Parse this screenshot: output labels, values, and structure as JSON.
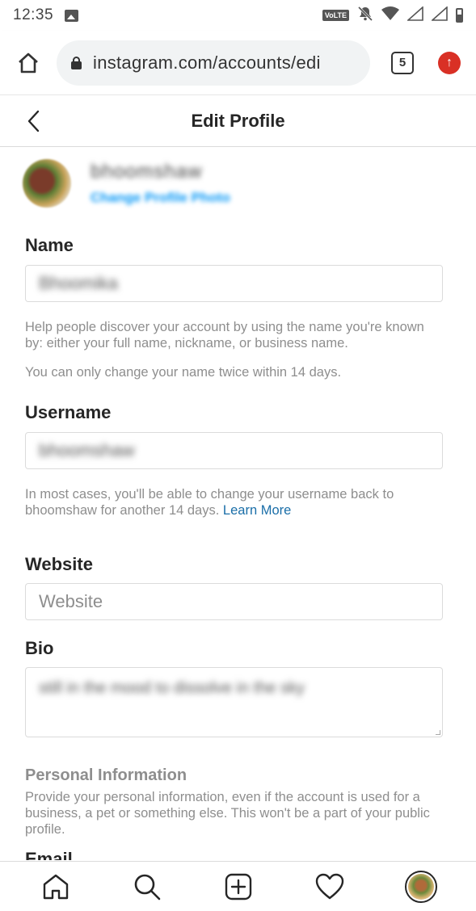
{
  "status_bar": {
    "time": "12:35",
    "volte": "VoLTE",
    "icons": [
      "image-icon",
      "mute-icon",
      "wifi-icon",
      "signal-icon",
      "battery-icon"
    ]
  },
  "browser": {
    "url": "instagram.com/accounts/edi",
    "tab_count": "5",
    "update_icon": "↑"
  },
  "header": {
    "title": "Edit Profile"
  },
  "profile": {
    "username_blurred": "bhoomshaw",
    "change_photo_blurred": "Change Profile Photo"
  },
  "form": {
    "name": {
      "label": "Name",
      "value_blurred": "Bhoomika",
      "help1": "Help people discover your account by using the name you're known by: either your full name, nickname, or business name.",
      "help2": "You can only change your name twice within 14 days."
    },
    "username": {
      "label": "Username",
      "value_blurred": "bhoomshaw",
      "help": "In most cases, you'll be able to change your username back to bhoomshaw for another 14 days.",
      "learn_more": "Learn More"
    },
    "website": {
      "label": "Website",
      "placeholder": "Website"
    },
    "bio": {
      "label": "Bio",
      "value_blurred": "still in the mood to dissolve in the sky"
    },
    "personal_info": {
      "title": "Personal Information",
      "help": "Provide your personal information, even if the account is used for a business, a pet or something else. This won't be a part of your public profile."
    },
    "email": {
      "label": "Email"
    }
  },
  "colors": {
    "link": "#0095f6",
    "learn_more": "#1a6ea8",
    "update": "#d93025",
    "muted_text": "#8e8e8e"
  }
}
